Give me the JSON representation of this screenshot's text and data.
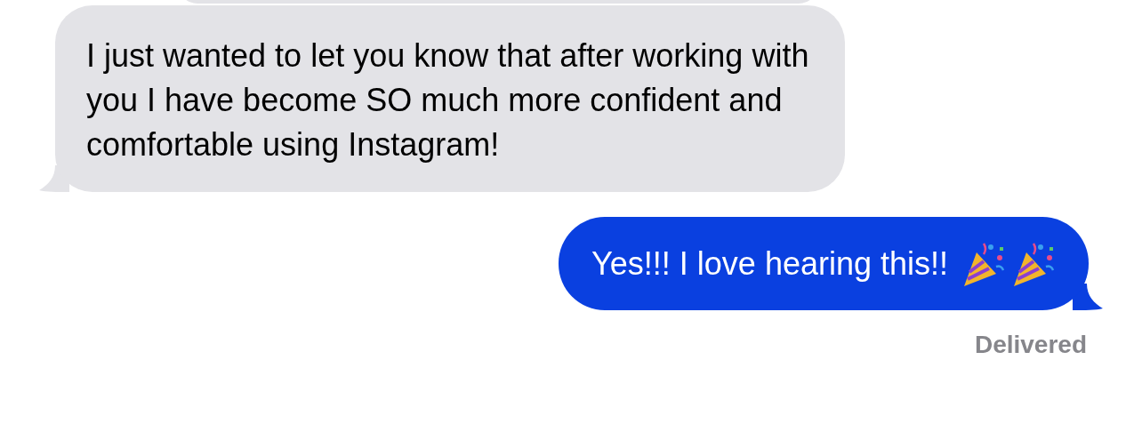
{
  "messages": [
    {
      "kind": "received",
      "text": "I just wanted to let you know that after working with you I have become SO much more confident and comfortable using Instagram!"
    },
    {
      "kind": "sent",
      "text": "Yes!!! I love hearing this!!"
    }
  ],
  "status": "Delivered"
}
